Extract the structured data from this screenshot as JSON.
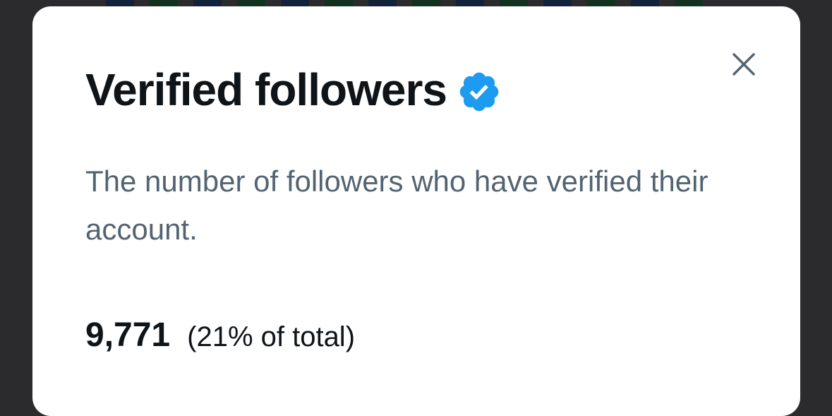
{
  "modal": {
    "title": "Verified followers",
    "badge_icon": "verified-badge-icon",
    "close_icon": "close-icon",
    "description": "The number of followers who have verified their account.",
    "stat": {
      "value": "9,771",
      "percent_text": "(21% of total)"
    }
  },
  "colors": {
    "backdrop": "#2b2b2d",
    "modal_background": "#ffffff",
    "title_text": "#0f1419",
    "description_text": "#536471",
    "badge_blue": "#1d9bf0",
    "close_icon": "#536471"
  }
}
